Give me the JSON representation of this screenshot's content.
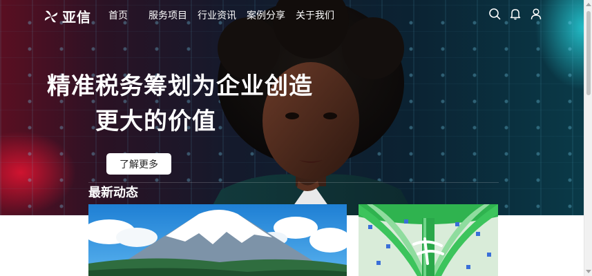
{
  "brand": {
    "name": "亚信"
  },
  "nav": {
    "items": [
      {
        "label": "首页"
      },
      {
        "label": "服务项目"
      },
      {
        "label": "行业资讯"
      },
      {
        "label": "案例分享"
      },
      {
        "label": "关于我们"
      }
    ]
  },
  "header_icons": [
    "search-icon",
    "bell-icon",
    "user-icon"
  ],
  "hero": {
    "title_line1": "精准税务筹划为企业创造",
    "title_line2": "更大的价值",
    "cta_label": "了解更多"
  },
  "news": {
    "section_title": "最新动态",
    "cards": [
      {
        "image": "mountain-illustration"
      },
      {
        "image": "green-arch-illustration"
      }
    ]
  },
  "colors": {
    "hero_left_glow": "#e6142f",
    "hero_right_glow": "#28dce6",
    "hero_bg": "#0b2232",
    "text_on_hero": "#ffffff",
    "cta_bg": "#ffffff"
  }
}
